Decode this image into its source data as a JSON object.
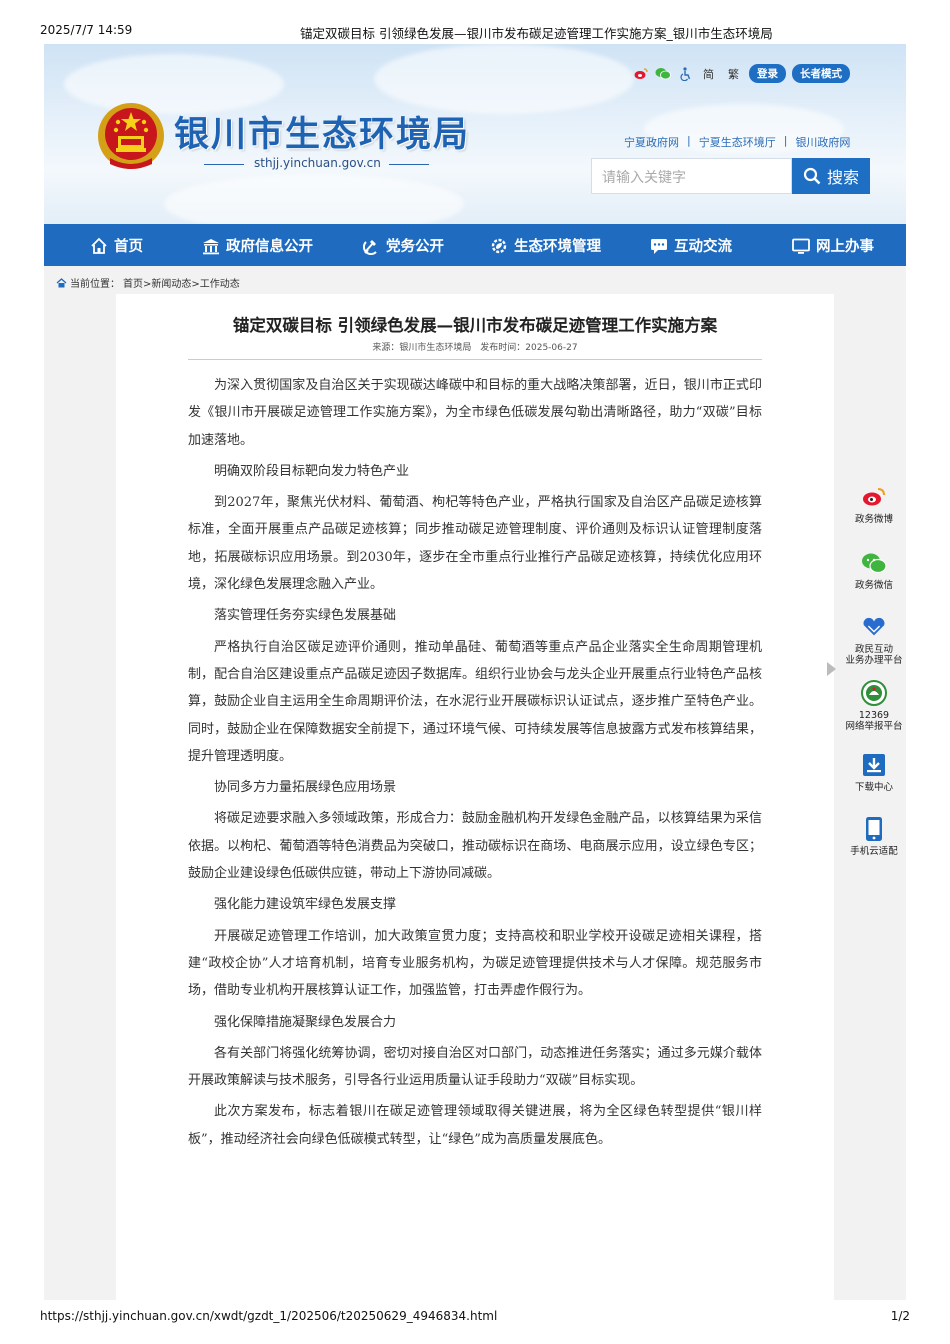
{
  "print_header": {
    "date": "2025/7/7 14:59",
    "title": "锚定双碳目标 引领绿色发展—银川市发布碳足迹管理工作实施方案_银川市生态环境局"
  },
  "print_footer": {
    "url": "https://sthjj.yinchuan.gov.cn/xwdt/gzdt_1/202506/t20250629_4946834.html",
    "page": "1/2"
  },
  "header": {
    "site_name": "银川市生态环境局",
    "site_url": "sthjj.yinchuan.gov.cn",
    "tools": {
      "simplified": "简",
      "traditional": "繁",
      "login": "登录",
      "elder_mode": "长者模式"
    },
    "links": [
      "宁夏政府网",
      "宁夏生态环境厅",
      "银川政府网"
    ],
    "search": {
      "placeholder": "请输入关键字",
      "button": "搜索"
    }
  },
  "nav": {
    "items": [
      {
        "label": "首页",
        "icon": "home-icon"
      },
      {
        "label": "政府信息公开",
        "icon": "government-building-icon"
      },
      {
        "label": "党务公开",
        "icon": "party-emblem-icon"
      },
      {
        "label": "生态环境管理",
        "icon": "ecology-gear-icon"
      },
      {
        "label": "互动交流",
        "icon": "chat-icon"
      },
      {
        "label": "网上办事",
        "icon": "monitor-icon"
      }
    ]
  },
  "breadcrumb": {
    "prefix": "当前位置：",
    "path": "首页>新闻动态>工作动态"
  },
  "article": {
    "title": "锚定双碳目标 引领绿色发展—银川市发布碳足迹管理工作实施方案",
    "source": "来源：银川市生态环境局",
    "date": "发布时间：2025-06-27",
    "paragraphs": [
      "为深入贯彻国家及自治区关于实现碳达峰碳中和目标的重大战略决策部署，近日，银川市正式印发《银川市开展碳足迹管理工作实施方案》，为全市绿色低碳发展勾勒出清晰路径，助力“双碳”目标加速落地。",
      "明确双阶段目标靶向发力特色产业",
      "到2027年，聚焦光伏材料、葡萄酒、枸杞等特色产业，严格执行国家及自治区产品碳足迹核算标准，全面开展重点产品碳足迹核算；同步推动碳足迹管理制度、评价通则及标识认证管理制度落地，拓展碳标识应用场景。到2030年，逐步在全市重点行业推行产品碳足迹核算，持续优化应用环境，深化绿色发展理念融入产业。",
      "落实管理任务夯实绿色发展基础",
      "严格执行自治区碳足迹评价通则，推动单晶硅、葡萄酒等重点产品企业落实全生命周期管理机制，配合自治区建设重点产品碳足迹因子数据库。组织行业协会与龙头企业开展重点行业特色产品核算，鼓励企业自主运用全生命周期评价法，在水泥行业开展碳标识认证试点，逐步推广至特色产业。同时，鼓励企业在保障数据安全前提下，通过环境气候、可持续发展等信息披露方式发布核算结果，提升管理透明度。",
      "协同多方力量拓展绿色应用场景",
      "将碳足迹要求融入多领域政策，形成合力：鼓励金融机构开发绿色金融产品，以核算结果为采信依据。以枸杞、葡萄酒等特色消费品为突破口，推动碳标识在商场、电商展示应用，设立绿色专区；鼓励企业建设绿色低碳供应链，带动上下游协同减碳。",
      "强化能力建设筑牢绿色发展支撑",
      "开展碳足迹管理工作培训，加大政策宣贯力度；支持高校和职业学校开设碳足迹相关课程，搭建“政校企协”人才培育机制，培育专业服务机构，为碳足迹管理提供技术与人才保障。规范服务市场，借助专业机构开展核算认证工作，加强监管，打击弄虚作假行为。",
      "强化保障措施凝聚绿色发展合力",
      "各有关部门将强化统筹协调，密切对接自治区对口部门，动态推进任务落实；通过多元媒介载体开展政策解读与技术服务，引导各行业运用质量认证手段助力“双碳”目标实现。",
      "此次方案发布，标志着银川在碳足迹管理领域取得关键进展，将为全区绿色转型提供“银川样板”，推动经济社会向绿色低碳模式转型，让“绿色”成为高质量发展底色。"
    ]
  },
  "float_bar": {
    "items": [
      {
        "label": "政务微博",
        "icon": "weibo-icon"
      },
      {
        "label": "政务微信",
        "icon": "wechat-icon"
      },
      {
        "label": "政民互动\n业务办理平台",
        "icon": "hands-heart-icon"
      },
      {
        "label": "12369\n网络举报平台",
        "icon": "environment-badge-icon"
      },
      {
        "label": "下载中心",
        "icon": "download-icon"
      },
      {
        "label": "手机云适配",
        "icon": "mobile-icon"
      }
    ]
  },
  "colors": {
    "brand_blue": "#1e6bc0",
    "site_name_blue": "#1e63b3",
    "page_bg": "#f2f2f2"
  }
}
